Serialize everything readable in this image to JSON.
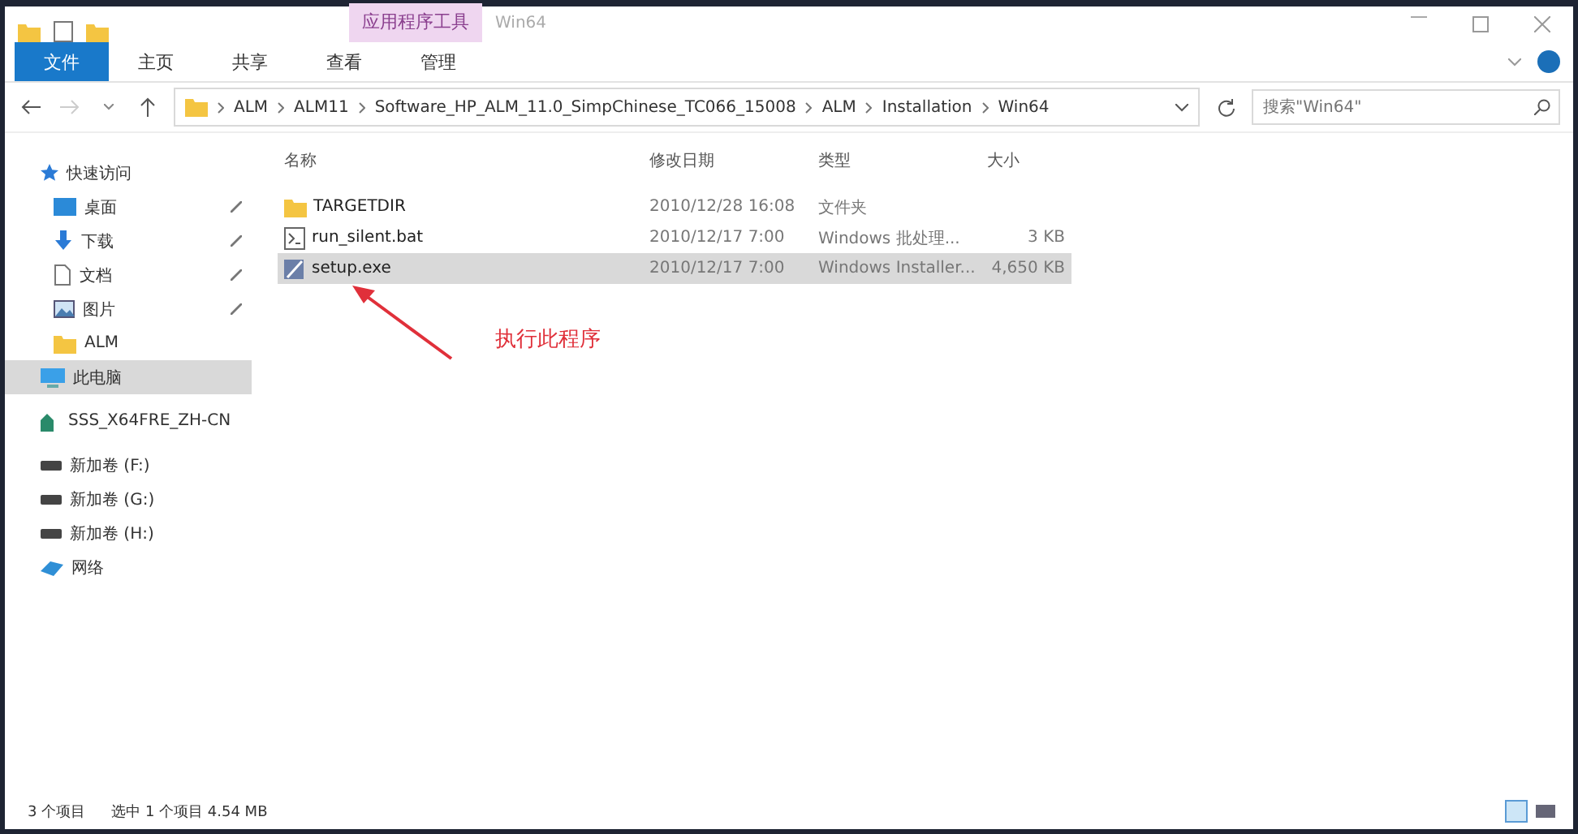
{
  "window": {
    "context_tab": "应用程序工具",
    "title": "Win64"
  },
  "ribbon_tabs": [
    {
      "label": "文件",
      "kind": "file"
    },
    {
      "label": "主页",
      "kind": "tab"
    },
    {
      "label": "共享",
      "kind": "tab"
    },
    {
      "label": "查看",
      "kind": "tab"
    },
    {
      "label": "管理",
      "kind": "tab"
    }
  ],
  "breadcrumb": [
    "ALM",
    "ALM11",
    "Software_HP_ALM_11.0_SimpChinese_TC066_15008",
    "ALM",
    "Installation",
    "Win64"
  ],
  "search": {
    "placeholder": "搜索\"Win64\""
  },
  "sidebar": [
    {
      "label": "快速访问",
      "kind": "star",
      "pinned": false,
      "selected": false,
      "children": [
        {
          "label": "桌面",
          "kind": "desktop",
          "pinned": true,
          "selected": false
        },
        {
          "label": "下载",
          "kind": "download",
          "pinned": true,
          "selected": false
        },
        {
          "label": "文档",
          "kind": "document",
          "pinned": true,
          "selected": false
        },
        {
          "label": "图片",
          "kind": "image",
          "pinned": true,
          "selected": false
        },
        {
          "label": "ALM",
          "kind": "folder",
          "pinned": false,
          "selected": false
        }
      ]
    },
    {
      "label": "此电脑",
      "kind": "computer",
      "pinned": false,
      "selected": true
    },
    {
      "label": "SSS_X64FRE_ZH-CN",
      "kind": "disc",
      "pinned": false,
      "selected": false
    },
    {
      "label": "新加卷 (F:)",
      "kind": "drive",
      "pinned": false,
      "selected": false
    },
    {
      "label": "新加卷 (G:)",
      "kind": "drive",
      "pinned": false,
      "selected": false
    },
    {
      "label": "新加卷 (H:)",
      "kind": "drive",
      "pinned": false,
      "selected": false
    },
    {
      "label": "网络",
      "kind": "network",
      "pinned": false,
      "selected": false
    }
  ],
  "table": {
    "columns": [
      "名称",
      "修改日期",
      "类型",
      "大小"
    ],
    "rows": [
      {
        "kind": "folder",
        "selected": false,
        "cells": [
          "TARGETDIR",
          "2010/12/28 16:08",
          "文件夹"
        ]
      },
      {
        "kind": "script",
        "selected": false,
        "cells": [
          "run_silent.bat",
          "2010/12/17 7:00",
          "Windows 批处理...",
          "3 KB"
        ]
      },
      {
        "kind": "installer",
        "selected": true,
        "cells": [
          "setup.exe",
          "2010/12/17 7:00",
          "Windows Installer...",
          "4,650 KB"
        ]
      }
    ]
  },
  "annotation": {
    "text": "执行此程序"
  },
  "status_bar": {
    "count": "3 个项目",
    "selection": "选中 1 个项目  4.54 MB"
  }
}
